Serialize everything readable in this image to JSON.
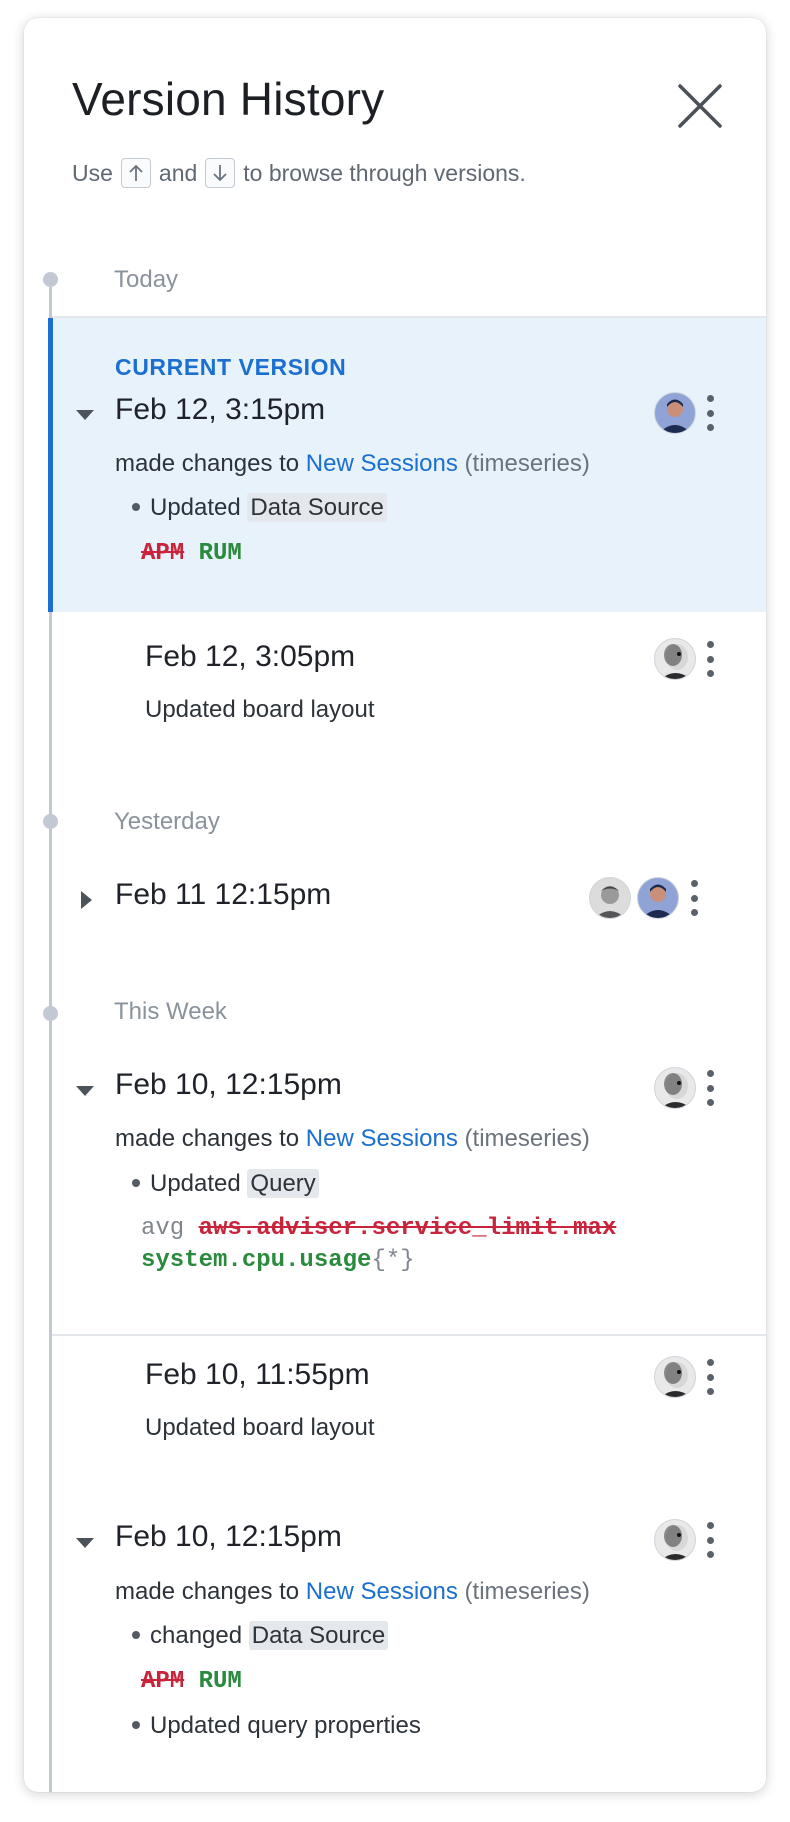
{
  "header": {
    "title": "Version History",
    "hint_use": "Use",
    "hint_and": "and",
    "hint_tail": "to browse through versions."
  },
  "groups": {
    "today": "Today",
    "yesterday": "Yesterday",
    "this_week": "This Week"
  },
  "current_label": "CURRENT VERSION",
  "versions": [
    {
      "date": "Feb 12, 3:15pm",
      "intro": "made changes to",
      "widget": "New Sessions",
      "widget_type": "(timeseries)",
      "bullet": "Updated",
      "field": "Data Source",
      "removed": "APM",
      "added": "RUM"
    },
    {
      "date": "Feb 12, 3:05pm",
      "summary": "Updated board layout"
    },
    {
      "date": "Feb 11 12:15pm"
    },
    {
      "date": "Feb 10, 12:15pm",
      "intro": "made changes to",
      "widget": "New Sessions",
      "widget_type": "(timeseries)",
      "bullet": "Updated",
      "field": "Query",
      "agg": "avg",
      "removed": "aws.adviser.service_limit.max",
      "added": "system.cpu.usage",
      "scope": "{*}"
    },
    {
      "date": "Feb 10, 11:55pm",
      "summary": "Updated board layout"
    },
    {
      "date": "Feb 10, 12:15pm",
      "intro": "made changes to",
      "widget": "New Sessions",
      "widget_type": "(timeseries)",
      "bullet": "changed",
      "field": "Data Source",
      "removed": "APM",
      "added": "RUM",
      "bullet2": "Updated query properties"
    }
  ],
  "colors": {
    "accent": "#1b6fd1",
    "current_bg": "#e8f2fb",
    "removed": "#c8243b",
    "added": "#2a8a3e"
  },
  "icons": [
    "close-icon",
    "arrow-up-icon",
    "arrow-down-icon",
    "caret-down-icon",
    "caret-right-icon",
    "kebab-icon",
    "avatar"
  ]
}
